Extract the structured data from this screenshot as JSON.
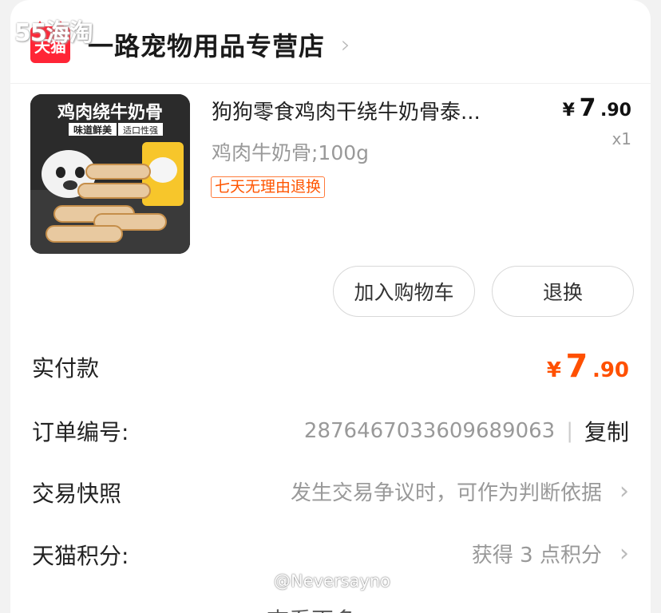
{
  "watermark_top": "55海淘",
  "shop": {
    "badge": "天猫",
    "name": "一路宠物用品专营店",
    "chevron": "›"
  },
  "product": {
    "image_text": "鸡肉绕牛奶骨",
    "image_subtext_1": "味道鲜美",
    "image_subtext_2": "适口性强",
    "title": "狗狗零食鸡肉干绕牛奶骨泰...",
    "spec": "鸡肉牛奶骨;100g",
    "tag": "七天无理由退换",
    "price_currency": "¥",
    "price_int": "7",
    "price_dec": ".90",
    "qty": "x1"
  },
  "actions": {
    "add_to_cart": "加入购物车",
    "return": "退换"
  },
  "rows": {
    "paid_label": "实付款",
    "paid_currency": "¥",
    "paid_int": "7",
    "paid_dec": ".90",
    "order_label": "订单编号:",
    "order_no": "2876467033609689063",
    "order_sep": "|",
    "copy": "复制",
    "snapshot_label": "交易快照",
    "snapshot_value": "发生交易争议时，可作为判断依据",
    "points_label": "天猫积分:",
    "points_value": "获得 3 点积分",
    "chevron": "›",
    "more": "查看更多"
  },
  "watermark_bottom": "@Neversayno",
  "colors": {
    "accent": "#ff5000",
    "tmall_red": "#ff2536",
    "background": "#f2f2f2"
  }
}
